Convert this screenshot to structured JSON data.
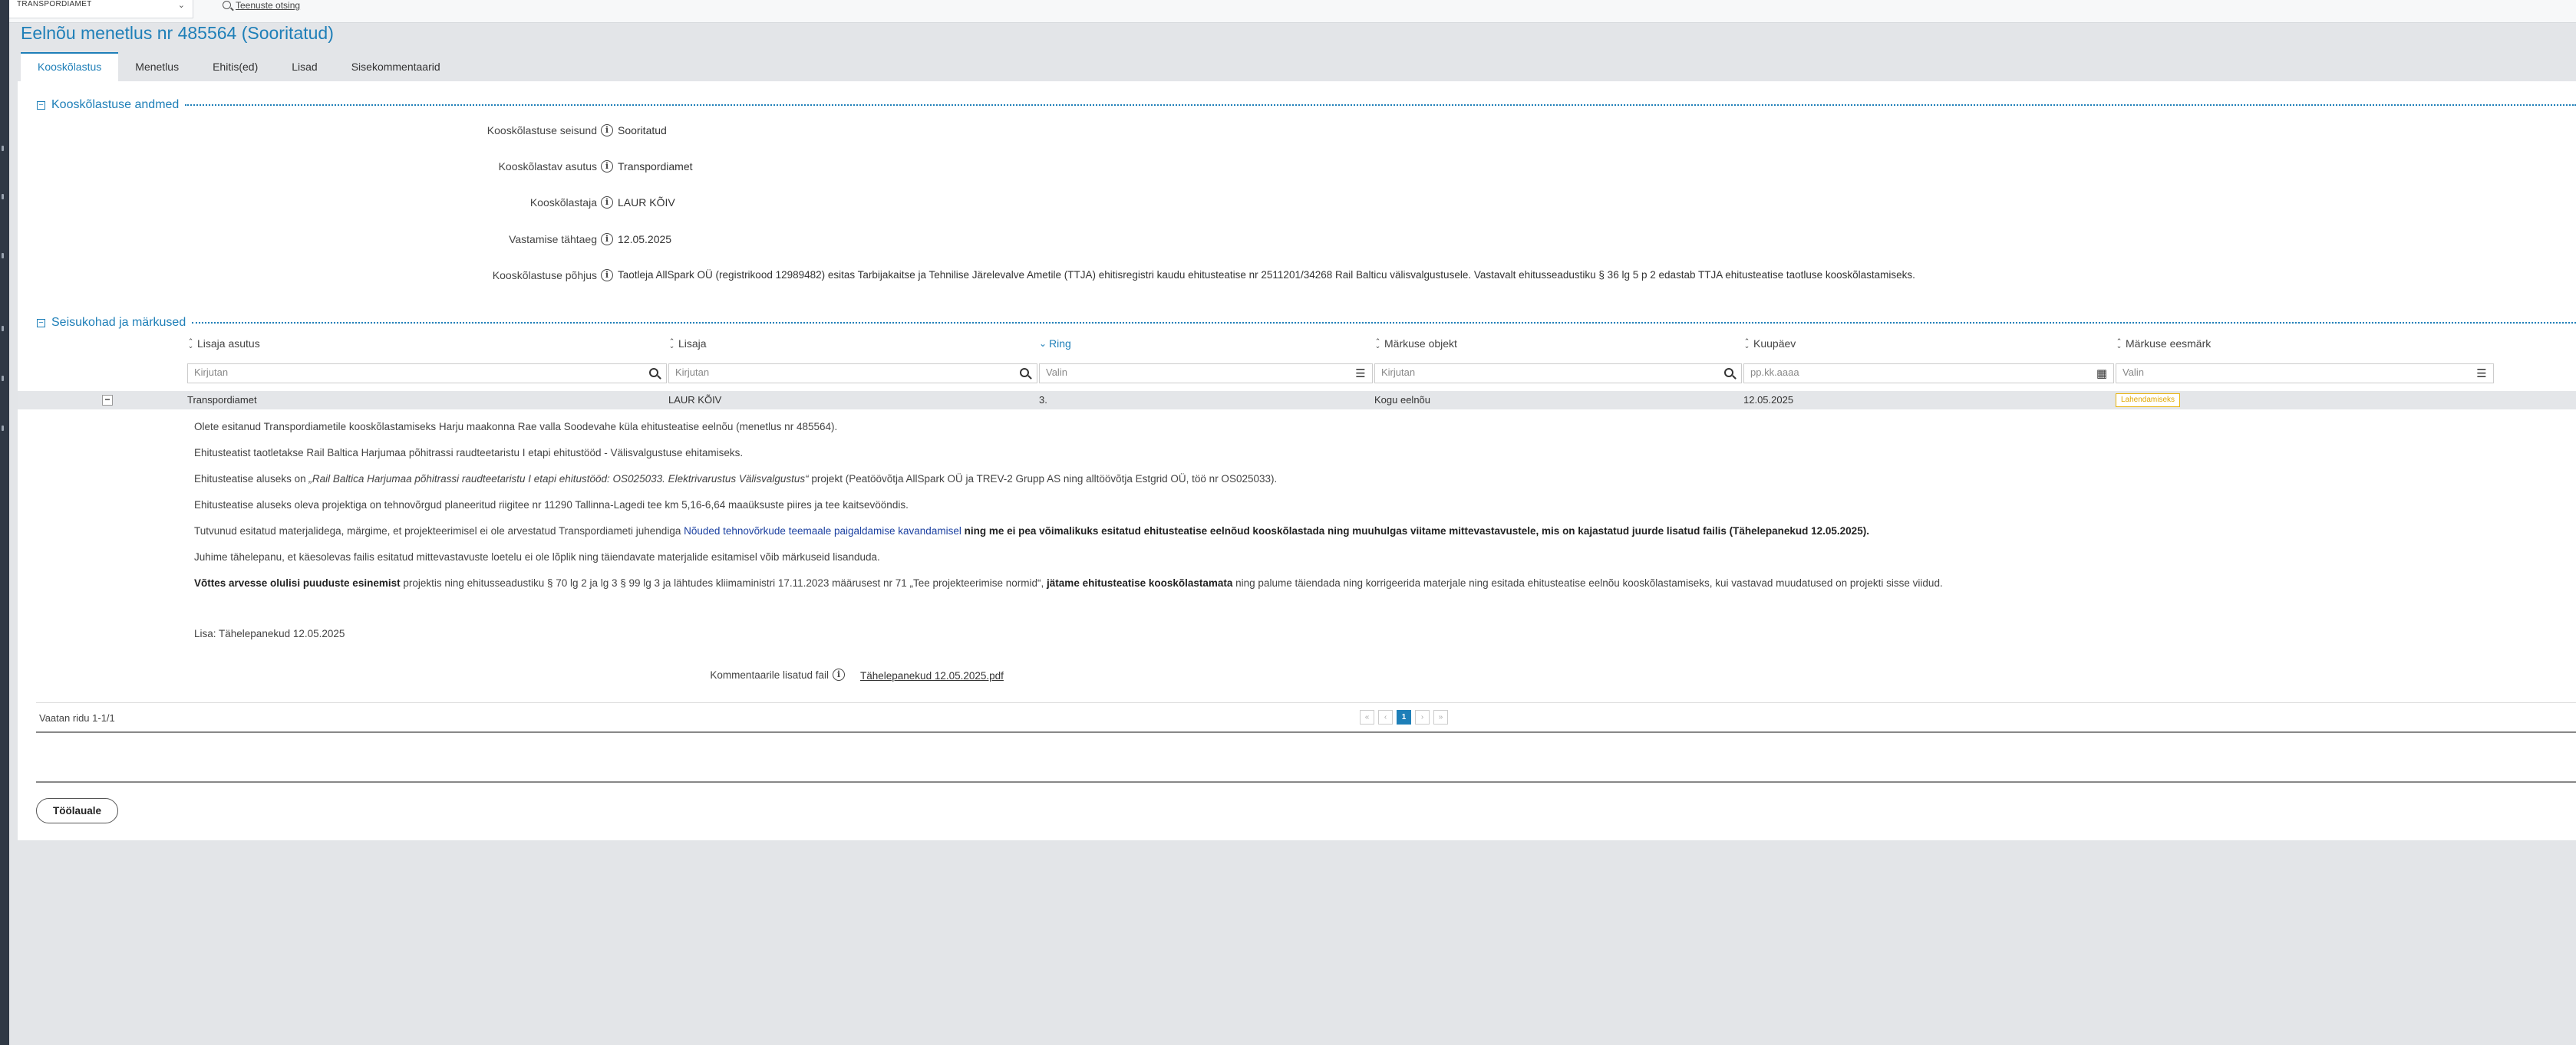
{
  "topbar": {
    "org_select_value": "TRANSPORDIAMET",
    "service_search_label": "Teenuste otsing"
  },
  "page_title": "Eelnõu menetlus nr 485564 (Sooritatud)",
  "tabs": [
    {
      "label": "Kooskõlastus",
      "active": true
    },
    {
      "label": "Menetlus"
    },
    {
      "label": "Ehitis(ed)"
    },
    {
      "label": "Lisad"
    },
    {
      "label": "Sisekommentaarid"
    }
  ],
  "section_approval": {
    "title": "Kooskõlastuse andmed",
    "fields": [
      {
        "label": "Kooskõlastuse seisund",
        "value": "Sooritatud"
      },
      {
        "label": "Kooskõlastav asutus",
        "value": "Transpordiamet"
      },
      {
        "label": "Kooskõlastaja",
        "value": "LAUR KÕIV"
      },
      {
        "label": "Vastamise tähtaeg",
        "value": "12.05.2025"
      },
      {
        "label": "Kooskõlastuse põhjus",
        "value": "Taotleja AllSpark OÜ (registrikood 12989482) esitas Tarbijakaitse ja Tehnilise Järelevalve Ametile (TTJA) ehitisregistri kaudu ehitusteatise nr 2511201/34268 Rail Balticu välisvalgustusele. Vastavalt ehitusseadustiku § 36 lg 5 p 2 edastab TTJA ehitusteatise taotluse kooskõlastamiseks."
      }
    ]
  },
  "section_remarks": {
    "title": "Seisukohad ja märkused",
    "columns": [
      {
        "label": "Lisaja asutus",
        "sorted": false
      },
      {
        "label": "Lisaja",
        "sorted": false
      },
      {
        "label": "Ring",
        "sorted": true
      },
      {
        "label": "Märkuse objekt",
        "sorted": false
      },
      {
        "label": "Kuupäev",
        "sorted": false
      },
      {
        "label": "Märkuse eesmärk",
        "sorted": false
      }
    ],
    "filters": [
      {
        "placeholder": "Kirjutan",
        "icon": "search-icon"
      },
      {
        "placeholder": "Kirjutan",
        "icon": "search-icon"
      },
      {
        "placeholder": "Valin",
        "icon": "list-icon"
      },
      {
        "placeholder": "Kirjutan",
        "icon": "search-icon"
      },
      {
        "placeholder": "pp.kk.aaaa",
        "icon": "calendar-icon"
      },
      {
        "placeholder": "Valin",
        "icon": "list-icon"
      }
    ],
    "row": {
      "org": "Transpordiamet",
      "author": "LAUR KÕIV",
      "round": "3.",
      "object": "Kogu eelnõu",
      "date": "12.05.2025",
      "purpose": "Lahendamiseks"
    },
    "comment": {
      "p1": "Olete esitanud Transpordiametile kooskõlastamiseks Harju maakonna Rae valla Soodevahe küla ehitusteatise eelnõu (menetlus nr 485564).",
      "p2": "Ehitusteatist taotletakse Rail Baltica Harjumaa põhitrassi raudteetaristu I etapi ehitustööd - Välisvalgustuse ehitamiseks.",
      "p3_a": "Ehitusteatise aluseks on ",
      "p3_em": "„Rail Baltica Harjumaa põhitrassi raudteetaristu I etapi ehitustööd: OS025033. Elektrivarustus Välisvalgustus“",
      "p3_b": " projekt (Peatöövõtja AllSpark OÜ ja TREV-2 Grupp AS ning alltöövõtja Estgrid OÜ, töö nr OS025033).",
      "p4": "Ehitusteatise aluseks oleva projektiga on tehnovõrgud planeeritud riigitee nr 11290 Tallinna-Lagedi tee km 5,16-6,64 maaüksuste piires ja tee kaitsevööndis.",
      "p5_a": "Tutvunud esitatud materjalidega, märgime, et projekteerimisel ei ole arvestatud Transpordiameti juhendiga ",
      "p5_link": "Nõuded tehnovõrkude teemaale paigaldamise kavandamisel",
      "p5_bold": " ning me ei pea võimalikuks esitatud ehitusteatise eelnõud kooskõlastada ning muuhulgas viitame mittevastavustele, mis on kajastatud juurde lisatud failis (Tähelepanekud 12.05.2025).",
      "p6": "Juhime tähelepanu, et käesolevas failis esitatud mittevastavuste loetelu ei ole lõplik ning täiendavate materjalide esitamisel võib märkuseid lisanduda.",
      "p7_bold1": "Võttes arvesse olulisi puuduste esinemist",
      "p7_a": " projektis ning ehitusseadustiku § 70 lg 2 ja lg 3 § 99 lg 3 ja lähtudes kliimaministri 17.11.2023 määrusest nr 71 „Tee projekteerimise normid“, ",
      "p7_bold2": "jätame ehitusteatise kooskõlastamata",
      "p7_b": " ning palume täiendada ning korrigeerida materjale ning esitada ehitusteatise eelnõu kooskõlastamiseks, kui vastavad muudatused on projekti sisse viidud.",
      "p8": "Lisa: Tähelepanekud 12.05.2025"
    },
    "attachment": {
      "label": "Kommentaarile lisatud fail",
      "file": "Tähelepanekud 12.05.2025.pdf"
    },
    "pager": {
      "summary": "Vaatan ridu 1-1/1",
      "first": "«",
      "prev": "‹",
      "current": "1",
      "next": "›",
      "last": "»"
    }
  },
  "back_button": "Töölauale",
  "colors": {
    "accent": "#1e7fb8",
    "badge": "#e8b40d"
  }
}
